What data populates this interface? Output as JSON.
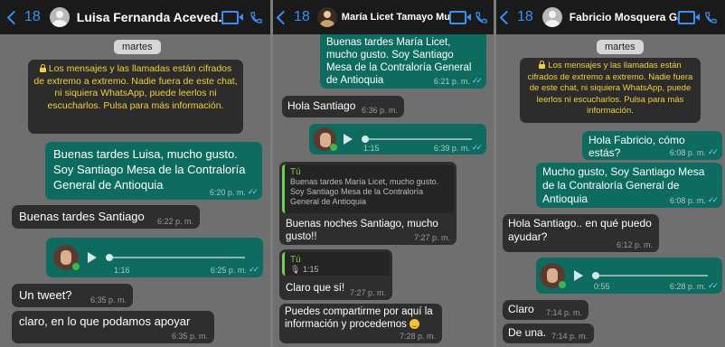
{
  "panels": [
    {
      "header": {
        "back_count": "18",
        "contact_name": "Luisa Fernanda Aceved..."
      },
      "date_label": "martes",
      "encryption": "Los mensajes y las llamadas están cifrados de extremo a extremo. Nadie fuera de este chat, ni siquiera WhatsApp, puede leerlos ni escucharlos. Pulsa para más información.",
      "messages": [
        {
          "dir": "out",
          "text": "Buenas tardes Luisa, mucho gusto. Soy Santiago Mesa de la Contraloría General de Antioquia",
          "time": "6:20 p. m."
        },
        {
          "dir": "in",
          "text": "Buenas tardes Santiago",
          "time": "6:22 p. m."
        },
        {
          "dir": "out",
          "type": "voice",
          "duration": "1:16",
          "time": "6:25 p. m."
        },
        {
          "dir": "in",
          "text": "Un tweet?",
          "time": "6:35 p. m."
        },
        {
          "dir": "in",
          "text": "claro, en lo que podamos apoyar",
          "time": "6:35 p. m."
        }
      ]
    },
    {
      "header": {
        "back_count": "18",
        "contact_name": "María Licet Tamayo Mu..."
      },
      "messages": [
        {
          "dir": "out",
          "text": "Buenas tardes María Licet, mucho gusto. Soy Santiago Mesa de la Contraloría General de Antioquia",
          "time": "6:21 p. m."
        },
        {
          "dir": "in",
          "text": "Hola Santiago",
          "time": "6:36 p. m."
        },
        {
          "dir": "out",
          "type": "voice",
          "duration": "1:15",
          "time": "6:39 p. m."
        },
        {
          "dir": "in",
          "quote_author": "Tú",
          "quote_text": "Buenas tardes María Licet, mucho gusto. Soy Santiago Mesa de la Contraloría General de Antioquia",
          "text": "Buenas noches Santiago, mucho gusto!!",
          "time": "7:27 p. m."
        },
        {
          "dir": "in",
          "quote_author": "Tú",
          "quote_text": "1:15",
          "text": "Claro que sí!",
          "time": "7:27 p. m."
        },
        {
          "dir": "in",
          "text": "Puedes compartirme por aquí la información y procedemos",
          "time": "7:28 p. m."
        }
      ]
    },
    {
      "header": {
        "back_count": "18",
        "contact_name": "Fabricio Mosquera Gar..."
      },
      "date_label": "martes",
      "encryption": "Los mensajes y las llamadas están cifrados de extremo a extremo. Nadie fuera de este chat, ni siquiera WhatsApp, puede leerlos ni escucharlos. Pulsa para más información.",
      "messages": [
        {
          "dir": "out",
          "text": "Hola Fabricio, cómo estás?",
          "time": "6:08 p. m."
        },
        {
          "dir": "out",
          "text": "Mucho gusto, Soy Santiago Mesa de la Contraloría General de Antioquia",
          "time": "6:08 p. m."
        },
        {
          "dir": "in",
          "text": "Hola Santiago.. en qué puedo ayudar?",
          "time": "6:12 p. m."
        },
        {
          "dir": "out",
          "type": "voice",
          "duration": "0:55",
          "time": "6:28 p. m."
        },
        {
          "dir": "in",
          "text": "Claro",
          "time": "7:14 p. m."
        },
        {
          "dir": "in",
          "text": "De una.",
          "time": "7:14 p. m."
        }
      ]
    }
  ],
  "colors": {
    "outgoing": "#0d6b5f",
    "incoming": "#2e2e2e",
    "accent": "#3d8ff5",
    "encryption_text": "#f2d03a"
  },
  "icons": {
    "back": "chevron-left-icon",
    "video": "video-call-icon",
    "phone": "phone-icon",
    "play": "play-icon",
    "read": "double-check-icon"
  }
}
